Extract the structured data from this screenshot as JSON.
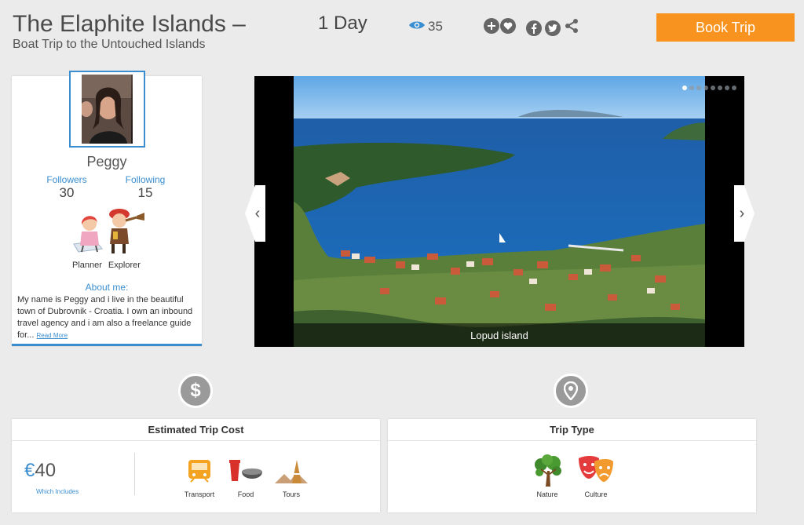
{
  "header": {
    "title": "The Elaphite Islands –",
    "subtitle": "Boat Trip to the Untouched Islands",
    "duration": "1 Day",
    "views": "35",
    "book_label": "Book Trip",
    "icons": [
      "add-icon",
      "heart-icon",
      "facebook-icon",
      "twitter-icon",
      "share-icon"
    ]
  },
  "profile": {
    "name": "Peggy",
    "followers_label": "Followers",
    "followers_count": "30",
    "following_label": "Following",
    "following_count": "15",
    "roles": [
      "Planner",
      "Explorer"
    ],
    "about_title": "About me:",
    "about_text": "My name is Peggy and i live in the beautiful town of Dubrovnik - Croatia. I own an inbound travel agency and i am also a freelance guide for...",
    "read_more": "Read More"
  },
  "gallery": {
    "caption": "Lopud island",
    "slide_count": 8,
    "active_slide": 1
  },
  "cost": {
    "title": "Estimated Trip Cost",
    "currency": "€",
    "amount": "40",
    "includes_label": "Which Includes",
    "items": [
      "Transport",
      "Food",
      "Tours"
    ]
  },
  "trip_type": {
    "title": "Trip Type",
    "items": [
      "Nature",
      "Culture"
    ]
  },
  "colors": {
    "accent": "#3a8ed0",
    "book_button": "#f7931e",
    "background": "#ebebeb"
  }
}
